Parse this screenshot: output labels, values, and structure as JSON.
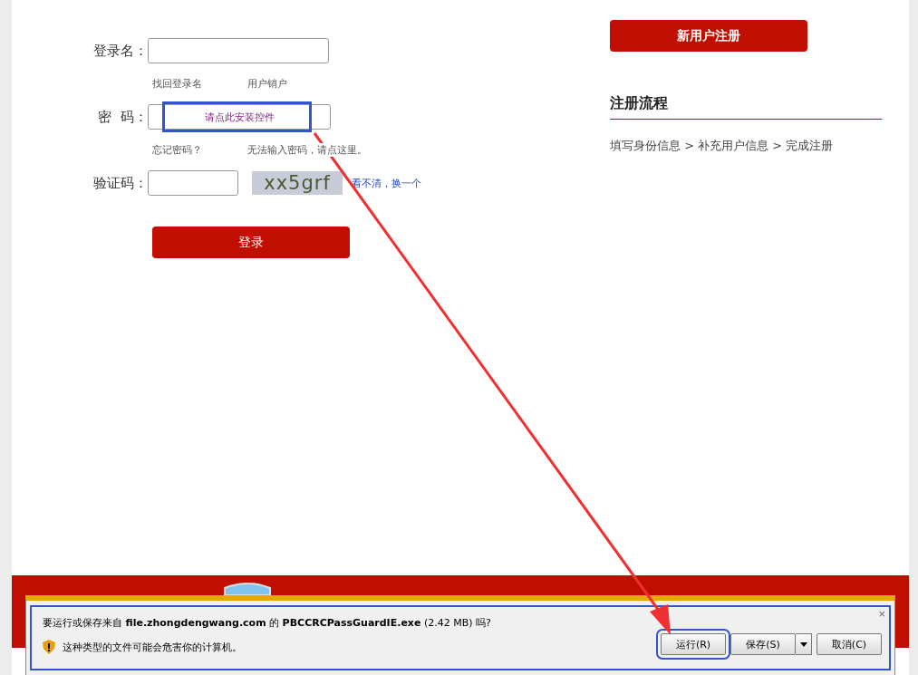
{
  "login_form": {
    "fields": [
      {
        "kind": "text",
        "label": "登录名：",
        "links": [
          "找回登录名",
          "用户销户"
        ]
      },
      {
        "kind": "control",
        "label": "密  码：",
        "control_text": "请点此安装控件",
        "links": [
          "忘记密码？",
          "无法输入密码，请点这里。"
        ]
      },
      {
        "kind": "captcha",
        "label": "验证码：",
        "captcha": "xx5grf",
        "refresh_link": "看不清，换一个"
      }
    ],
    "submit": "登录"
  },
  "register": {
    "button": "新用户注册",
    "process_title": "注册流程",
    "process_steps": "填写身份信息 > 补充用户信息 > 完成注册"
  },
  "download_bar": {
    "message": "要运行或保存来自 **file.zhongdengwang.com** 的 **PBCCRCPassGuardIE.exe** (2.42 MB) 吗?",
    "warning": "这种类型的文件可能会危害你的计算机。",
    "buttons": [
      {
        "label": "运行(R)",
        "kind": "plain"
      },
      {
        "label": "保存(S)",
        "kind": "split"
      },
      {
        "label": "取消(C)",
        "kind": "plain"
      }
    ],
    "close": "×"
  }
}
